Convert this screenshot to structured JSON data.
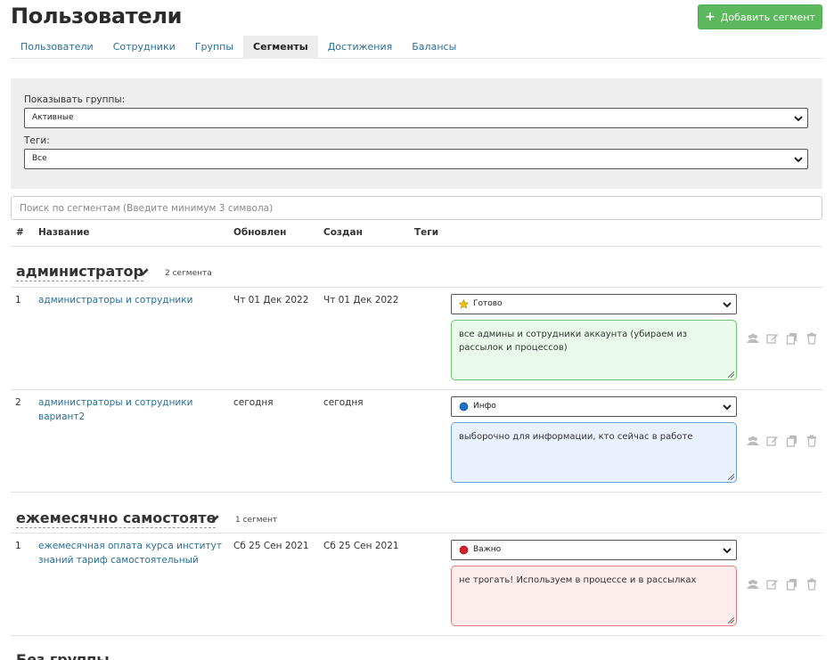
{
  "header": {
    "title": "Пользователи",
    "add_button_label": "Добавить сегмент"
  },
  "tabs": [
    {
      "label": "Пользователи"
    },
    {
      "label": "Сотрудники"
    },
    {
      "label": "Группы"
    },
    {
      "label": "Сегменты",
      "active": true
    },
    {
      "label": "Достижения"
    },
    {
      "label": "Балансы"
    }
  ],
  "filters": {
    "groups_label": "Показывать группы:",
    "groups_value": "Активные",
    "tags_label": "Теги:",
    "tags_value": "Все"
  },
  "search": {
    "placeholder": "Поиск по сегментам (Введите минимум 3 символа)"
  },
  "table": {
    "columns": [
      "#",
      "Название",
      "Обновлен",
      "Создан",
      "Теги"
    ]
  },
  "groups": [
    {
      "title": "администратор",
      "count": "2 сегмента",
      "rows": [
        {
          "num": "1",
          "name": "администраторы и сотрудники",
          "updated": "Чт 01 Дек 2022",
          "created": "Чт 01 Дек 2022",
          "tag": "Готово",
          "tag_icon": "star-icon",
          "note": "все админы и сотрудники аккаунта (убираем из рассылок и процессов)"
        },
        {
          "num": "2",
          "name": "администраторы и сотрудники вариант2",
          "updated": "сегодня",
          "created": "сегодня",
          "tag": "Инфо",
          "tag_icon": "blue-circle-icon",
          "note": "выборочно для информации, кто сейчас в работе"
        }
      ]
    },
    {
      "title": "ежемесячно самостояте",
      "count": "1 сегмент",
      "rows": [
        {
          "num": "1",
          "name": "ежемесячная оплата курса институт знаний тариф самостоятельный",
          "updated": "Сб 25 Сен 2021",
          "created": "Сб 25 Сен 2021",
          "tag": "Важно",
          "tag_icon": "red-circle-icon",
          "note": "не трогать! Используем в процессе и в рассылках"
        }
      ]
    }
  ],
  "next_group_title": "Без группы",
  "colors": {
    "accent": "#5cb85c",
    "link": "#2a6f97",
    "note_green": "#eafaea",
    "note_blue": "#e9f2fc",
    "note_red": "#fdecec",
    "dot_blue": "#1e6fc9",
    "dot_red": "#d61f2c",
    "star": "#f2c200"
  }
}
